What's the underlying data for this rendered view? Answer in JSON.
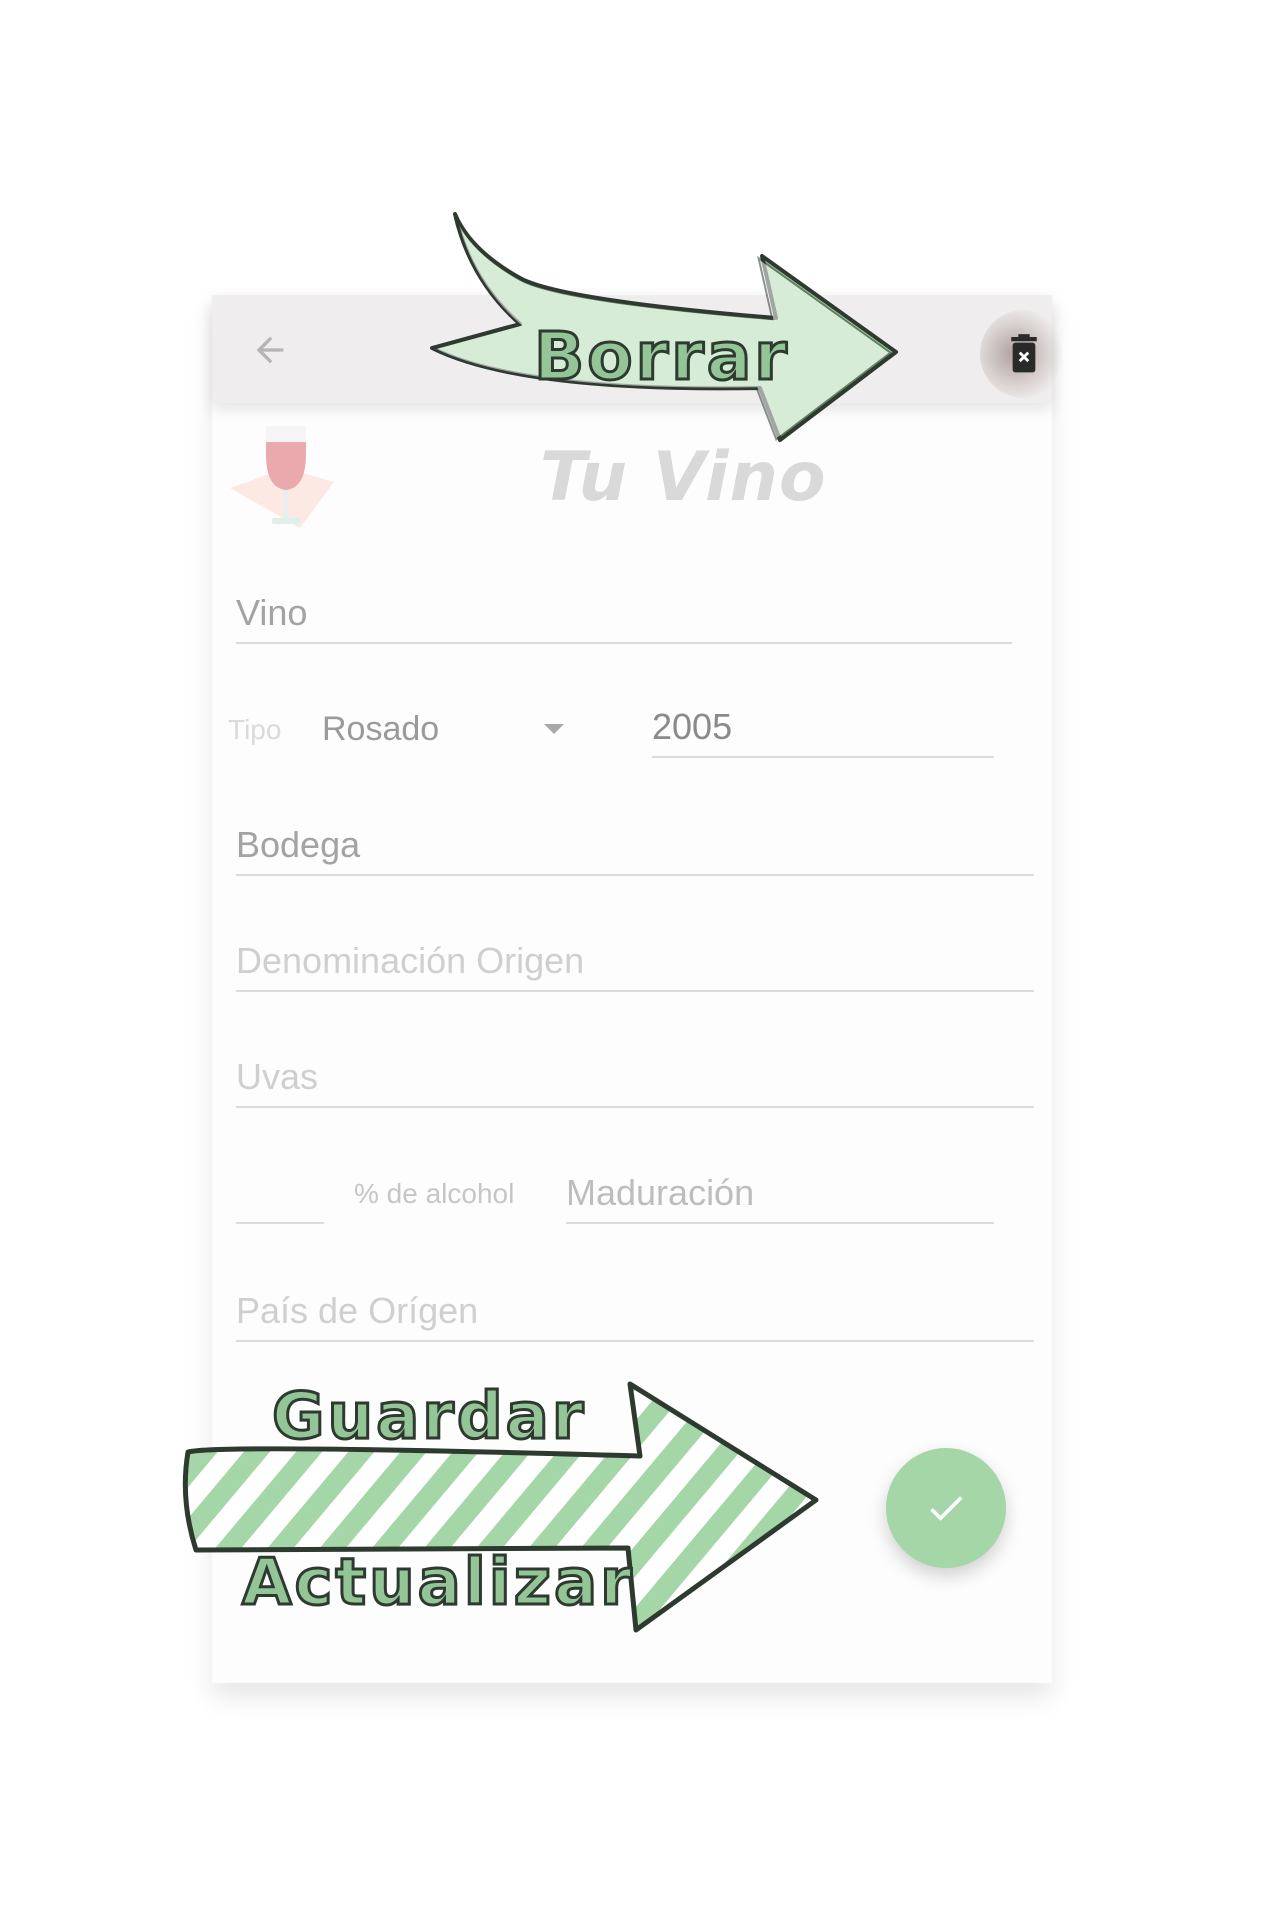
{
  "appbar": {
    "back_icon": "arrow-left-icon",
    "delete_icon": "trash-can-icon"
  },
  "brand": {
    "title": "Tu Vino",
    "logo_icon": "wine-glass-logo"
  },
  "form": {
    "wine_placeholder": "Vino",
    "type_label": "Tipo",
    "type_value": "Rosado",
    "year_value": "2005",
    "winery_placeholder": "Bodega",
    "origin_placeholder": "Denominación Origen",
    "grapes_placeholder": "Uvas",
    "alcohol_label": "% de alcohol",
    "aging_placeholder": "Maduración",
    "country_placeholder": "País de Orígen"
  },
  "fab": {
    "icon": "check-icon",
    "color": "#a5d6a7"
  },
  "annotations": {
    "delete_callout": "Borrar",
    "save_callout_line1": "Guardar",
    "save_callout_line2": "Actualizar",
    "arrow_color": "#93c596"
  }
}
